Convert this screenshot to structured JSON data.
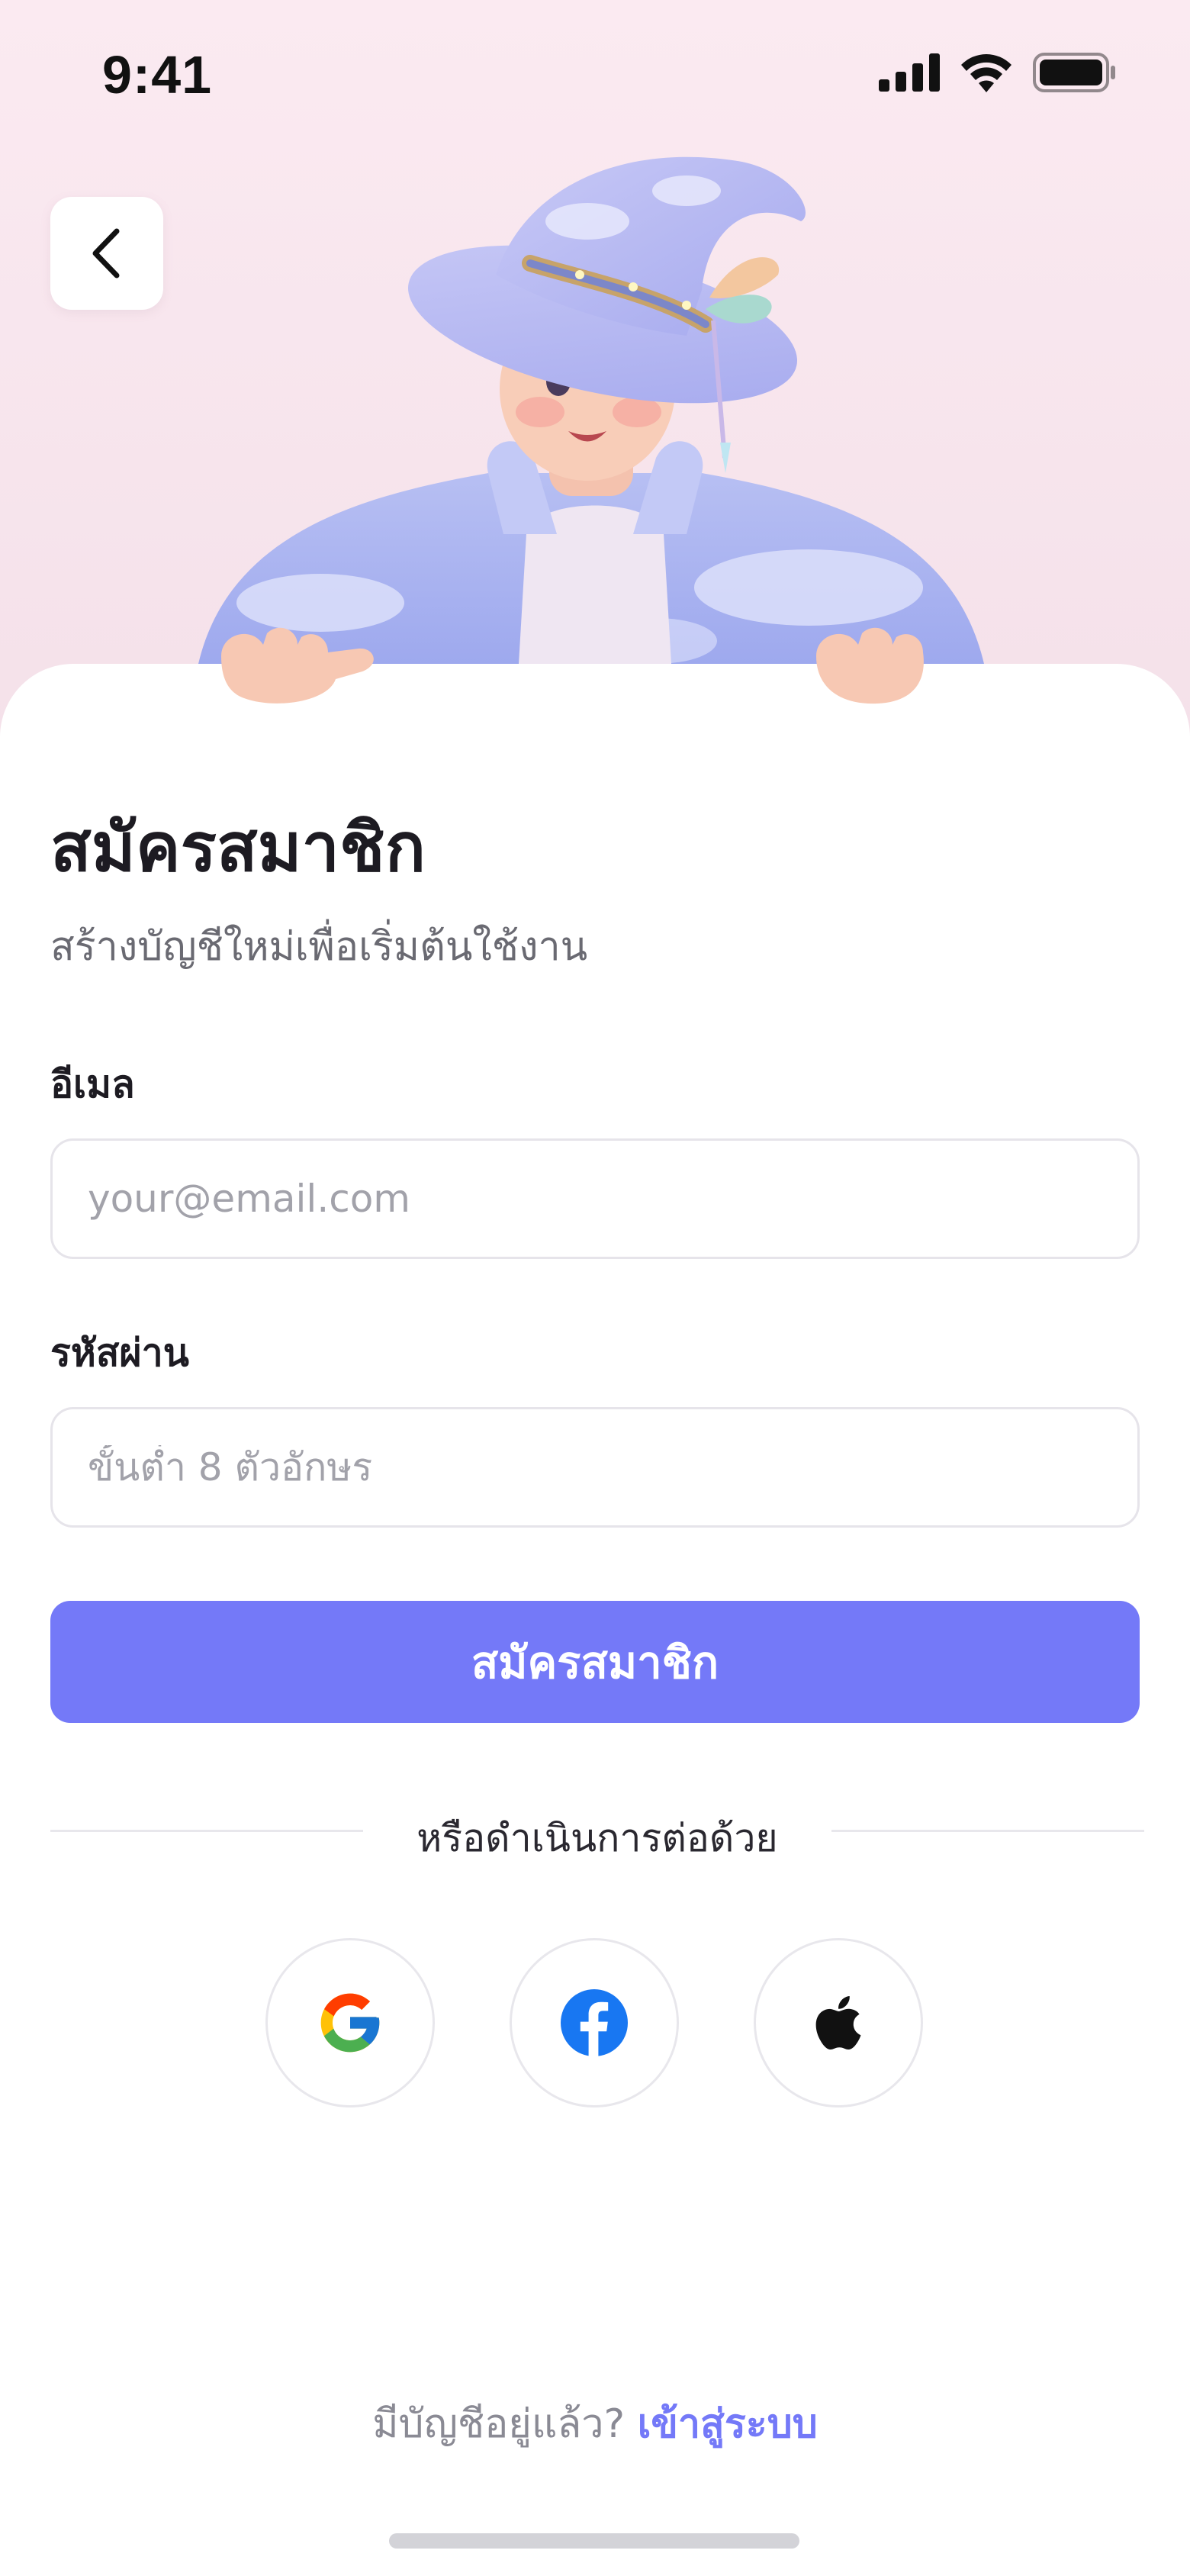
{
  "status_bar": {
    "time": "9:41"
  },
  "back_button": {
    "icon": "chevron-left-icon"
  },
  "hero": {
    "description_icon": "wizard-character-illustration"
  },
  "header": {
    "title": "สมัครสมาชิก",
    "subtitle": "สร้างบัญชีใหม่เพื่อเริ่มต้นใช้งาน"
  },
  "form": {
    "email_label": "อีเมล",
    "email_placeholder": "your@email.com",
    "email_value": "",
    "password_label": "รหัสผ่าน",
    "password_placeholder": "ขั้นต่ำ 8 ตัวอักษร",
    "password_value": "",
    "submit_label": "สมัครสมาชิก"
  },
  "divider": {
    "text": "หรือดำเนินการต่อด้วย"
  },
  "social": [
    {
      "name": "google",
      "icon": "google-icon"
    },
    {
      "name": "facebook",
      "icon": "facebook-icon"
    },
    {
      "name": "apple",
      "icon": "apple-icon"
    }
  ],
  "footer": {
    "prompt": "มีบัญชีอยู่แล้ว?",
    "link": "เข้าสู่ระบบ"
  },
  "colors": {
    "primary": "#7479f8",
    "background_top": "#fbeaf1",
    "text_dark": "#1d1b22",
    "text_muted": "#6a6a72"
  }
}
